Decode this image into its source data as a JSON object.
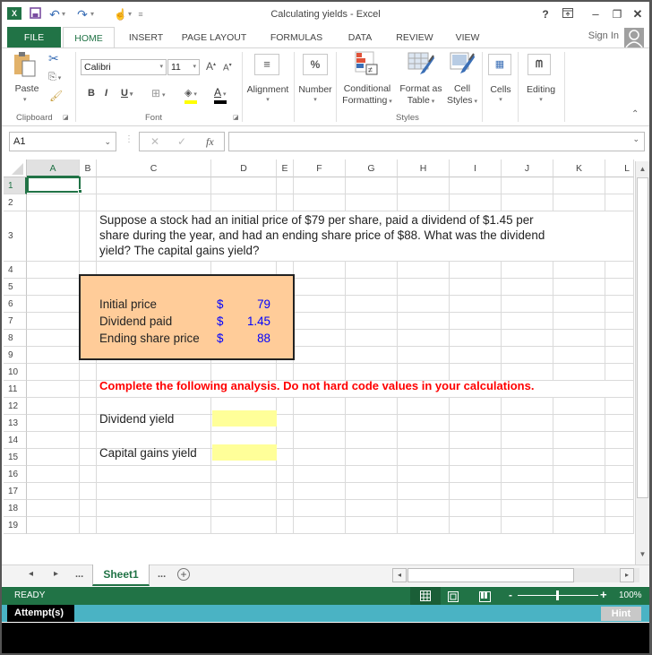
{
  "window": {
    "title": "Calculating yields - Excel",
    "controls": {
      "help": "?",
      "ribbon_display": "⊡",
      "minimize": "–",
      "restore": "❐",
      "close": "✕"
    }
  },
  "qat": {
    "app_icon": "excel-logo-icon",
    "save": "save-icon",
    "undo": "undo-icon",
    "redo": "redo-icon",
    "touch": "touch-mode-icon",
    "customize": "customize-qat-icon"
  },
  "tabs": [
    {
      "label": "FILE"
    },
    {
      "label": "HOME"
    },
    {
      "label": "INSERT"
    },
    {
      "label": "PAGE LAYOUT"
    },
    {
      "label": "FORMULAS"
    },
    {
      "label": "DATA"
    },
    {
      "label": "REVIEW"
    },
    {
      "label": "VIEW"
    }
  ],
  "account": {
    "sign_in": "Sign In"
  },
  "ribbon": {
    "clipboard": {
      "paste": "Paste",
      "group": "Clipboard"
    },
    "font": {
      "name": "Calibri",
      "size": "11",
      "bold": "B",
      "italic": "I",
      "underline": "U",
      "grow": "A",
      "shrink": "A",
      "font_color": "A",
      "group": "Font"
    },
    "alignment": {
      "label": "Alignment"
    },
    "number": {
      "label": "Number",
      "icon": "%"
    },
    "styles": {
      "conditional_1": "Conditional",
      "conditional_2": "Formatting",
      "format_table_1": "Format as",
      "format_table_2": "Table",
      "cell_styles_1": "Cell",
      "cell_styles_2": "Styles",
      "group": "Styles"
    },
    "cells": {
      "label": "Cells"
    },
    "editing": {
      "label": "Editing"
    }
  },
  "formula_bar": {
    "name_box": "A1",
    "cancel": "✕",
    "enter": "✓",
    "fx": "fx",
    "formula": ""
  },
  "columns": [
    "A",
    "B",
    "C",
    "D",
    "E",
    "F",
    "G",
    "H",
    "I",
    "J",
    "K",
    "L"
  ],
  "rows": [
    "1",
    "2",
    "3",
    "4",
    "5",
    "6",
    "7",
    "8",
    "9",
    "10",
    "11",
    "12",
    "13",
    "14",
    "15",
    "16",
    "17",
    "18",
    "19"
  ],
  "sheet": {
    "question_line1": "Suppose a stock had an initial price of $79 per share, paid a dividend of $1.45 per",
    "question_line2": "share during the year, and had an ending share price of $88. What was the dividend",
    "question_line3": "yield? The capital gains yield?",
    "inputs": [
      {
        "label": "Initial price",
        "currency": "$",
        "value": "79"
      },
      {
        "label": "Dividend paid",
        "currency": "$",
        "value": "1.45"
      },
      {
        "label": "Ending share price",
        "currency": "$",
        "value": "88"
      }
    ],
    "instruction": "Complete the following analysis. Do not hard code values in your calculations.",
    "dividend_yield_label": "Dividend yield",
    "dividend_yield_value": "",
    "capital_gains_label": "Capital gains yield",
    "capital_gains_value": ""
  },
  "sheet_tabs": {
    "prev": "◂",
    "next": "▸",
    "ellipsis_left": "...",
    "active": "Sheet1",
    "ellipsis_right": "...",
    "add": "+"
  },
  "status": {
    "mode": "READY",
    "zoom": "100%",
    "zoom_minus": "-",
    "zoom_plus": "+"
  },
  "attempt_bar": {
    "label": "Attempt(s)",
    "hint": "Hint"
  },
  "colors": {
    "excel_green": "#217346",
    "input_fill": "#ffcc99",
    "answer_fill": "#ffff99",
    "instruction_red": "#ff0000",
    "value_blue": "#0000ff",
    "attempt_teal": "#4ab3c4"
  }
}
